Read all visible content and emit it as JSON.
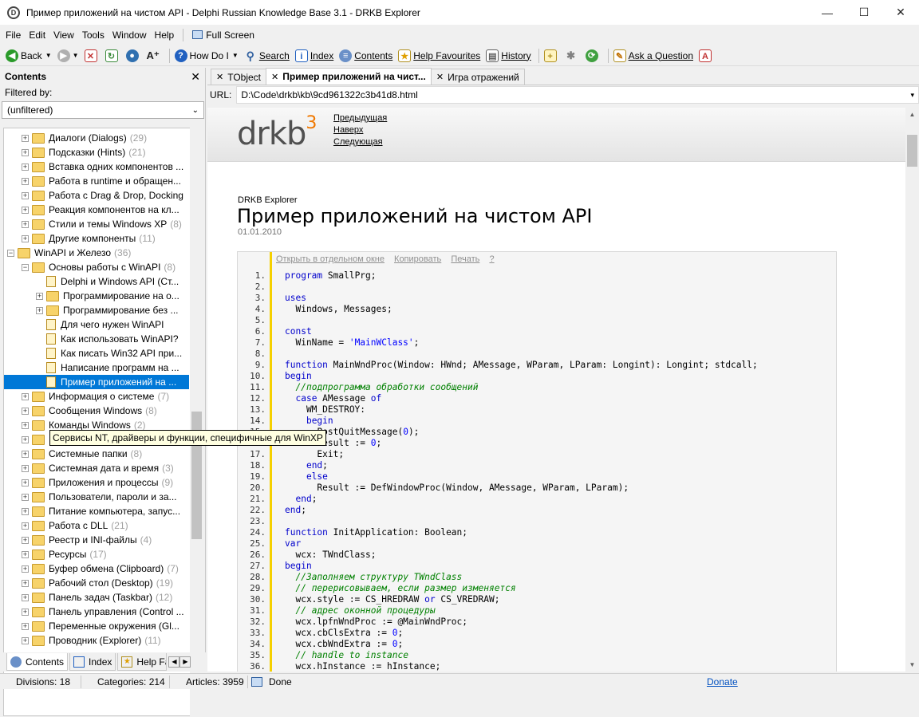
{
  "window": {
    "title": "Пример приложений на чистом API - Delphi Russian Knowledge Base 3.1 - DRKB Explorer",
    "minimize": "—",
    "maximize": "☐",
    "close": "✕",
    "icon": "drkb-logo-icon"
  },
  "menu": [
    "File",
    "Edit",
    "View",
    "Tools",
    "Window",
    "Help"
  ],
  "fullscreen": "Full Screen",
  "toolbar": {
    "back": "Back",
    "howdoi": "How Do I",
    "search": "Search",
    "index": "Index",
    "contents": "Contents",
    "help_fav": "Help Favourites",
    "history": "History",
    "ask": "Ask a Question",
    "font_plus": "A⁺"
  },
  "contents_panel": {
    "title": "Contents",
    "close": "✕",
    "filtered_by": "Filtered by:",
    "filter_value": "(unfiltered)",
    "items": [
      {
        "label": "Диалоги (Dialogs)",
        "count": "(29)"
      },
      {
        "label": "Подсказки (Hints)",
        "count": "(21)"
      },
      {
        "label": "Вставка одних компонентов ...",
        "count": ""
      },
      {
        "label": "Работа в runtime и обращен...",
        "count": ""
      },
      {
        "label": "Работа с Drag & Drop, Docking",
        "count": ""
      },
      {
        "label": "Реакция компонентов на кл...",
        "count": ""
      },
      {
        "label": "Стили и темы Windows XP",
        "count": "(8)"
      },
      {
        "label": "Другие компоненты",
        "count": "(11)"
      },
      {
        "label": "WinAPI и Железо",
        "count": "(36)"
      },
      {
        "label": "Основы работы с WinAPI",
        "count": "(8)"
      },
      {
        "label": "Delphi и Windows API (Ст...",
        "count": ""
      },
      {
        "label": "Программирование на о...",
        "count": ""
      },
      {
        "label": "Программирование без ...",
        "count": ""
      },
      {
        "label": "Для чего нужен WinAPI",
        "count": ""
      },
      {
        "label": "Как использовать WinAPI?",
        "count": ""
      },
      {
        "label": "Как писать Win32 API при...",
        "count": ""
      },
      {
        "label": "Написание программ на ...",
        "count": ""
      },
      {
        "label": "Пример приложений на ...",
        "count": ""
      },
      {
        "label": "Информация о системе",
        "count": "(7)"
      },
      {
        "label": "Сообщения Windows",
        "count": "(8)"
      },
      {
        "label": "Команды Windows",
        "count": "(2)"
      },
      {
        "label": "Сервисы NT, драйверы и функции, специфичные для WinXP",
        "count": ""
      },
      {
        "label": "Системные папки",
        "count": "(8)"
      },
      {
        "label": "Системная дата и время",
        "count": "(3)"
      },
      {
        "label": "Приложения и процессы",
        "count": "(9)"
      },
      {
        "label": "Пользователи, пароли и за...",
        "count": ""
      },
      {
        "label": "Питание компьютера, запус...",
        "count": ""
      },
      {
        "label": "Работа с DLL",
        "count": "(21)"
      },
      {
        "label": "Реестр и INI-файлы",
        "count": "(4)"
      },
      {
        "label": "Ресурсы",
        "count": "(17)"
      },
      {
        "label": "Буфер обмена (Clipboard)",
        "count": "(7)"
      },
      {
        "label": "Рабочий стол (Desktop)",
        "count": "(19)"
      },
      {
        "label": "Панель задач (Taskbar)",
        "count": "(12)"
      },
      {
        "label": "Панель управления (Control ...",
        "count": ""
      },
      {
        "label": "Переменные окружения (Gl...",
        "count": ""
      },
      {
        "label": "Проводник (Explorer)",
        "count": "(11)"
      }
    ],
    "tooltip": "Сервисы NT, драйверы и функции, специфичные для WinXP",
    "tabs": {
      "contents": "Contents",
      "index": "Index",
      "favs": "Help Fa"
    }
  },
  "doc_tabs": [
    {
      "label": "TObject"
    },
    {
      "label": "Пример приложений на чист..."
    },
    {
      "label": "Игра отражений"
    }
  ],
  "url": {
    "label": "URL:",
    "value": "D:\\Code\\drkb\\kb\\9cd961322c3b41d8.html"
  },
  "page": {
    "logo": "drkb",
    "logo_sup": "3",
    "nav": [
      "Предыдущая",
      "Наверх",
      "Следующая"
    ],
    "subhead": "DRKB Explorer",
    "title": "Пример приложений на чистом API",
    "date": "01.01.2010",
    "code_tools": [
      "Открыть в отдельном окне",
      "Копировать",
      "Печать",
      "?"
    ],
    "code": [
      "<k>program</k> SmallPrg;",
      "",
      "<k>uses</k>",
      "  Windows, Messages;",
      "",
      "<k>const</k>",
      "  WinName = <s>'MainWClass'</s>;",
      "",
      "<k>function</k> MainWndProc(Window: HWnd; AMessage, WParam, LParam: Longint): Longint; stdcall;",
      "<k>begin</k>",
      "  <c>//подпрограмма обработки сообщений</c>",
      "  <k>case</k> AMessage <k>of</k>",
      "    WM_DESTROY:",
      "    <k>begin</k>",
      "      PostQuitMessage(<n>0</n>);",
      "      Result := <n>0</n>;",
      "      Exit;",
      "    <k>end</k>;",
      "    <k>else</k>",
      "      Result := DefWindowProc(Window, AMessage, WParam, LParam);",
      "  <k>end</k>;",
      "<k>end</k>;",
      "",
      "<k>function</k> InitApplication: Boolean;",
      "<k>var</k>",
      "  wcx: TWndClass;",
      "<k>begin</k>",
      "  <c>//Заполняем структуру TWndClass</c>",
      "  <c>// перерисовываем, если размер изменяется</c>",
      "  wcx.style := CS_HREDRAW <k>or</k> CS_VREDRAW;",
      "  <c>// адрес оконной процедуры</c>",
      "  wcx.lpfnWndProc := @MainWndProc;",
      "  wcx.cbClsExtra := <n>0</n>;",
      "  wcx.cbWndExtra := <n>0</n>;",
      "  <c>// handle to instance</c>",
      "  wcx.hInstance := hInstance;"
    ]
  },
  "status": {
    "divisions": "Divisions: 18",
    "categories": "Categories: 214",
    "articles": "Articles: 3959",
    "done": "Done",
    "donate": "Donate"
  }
}
